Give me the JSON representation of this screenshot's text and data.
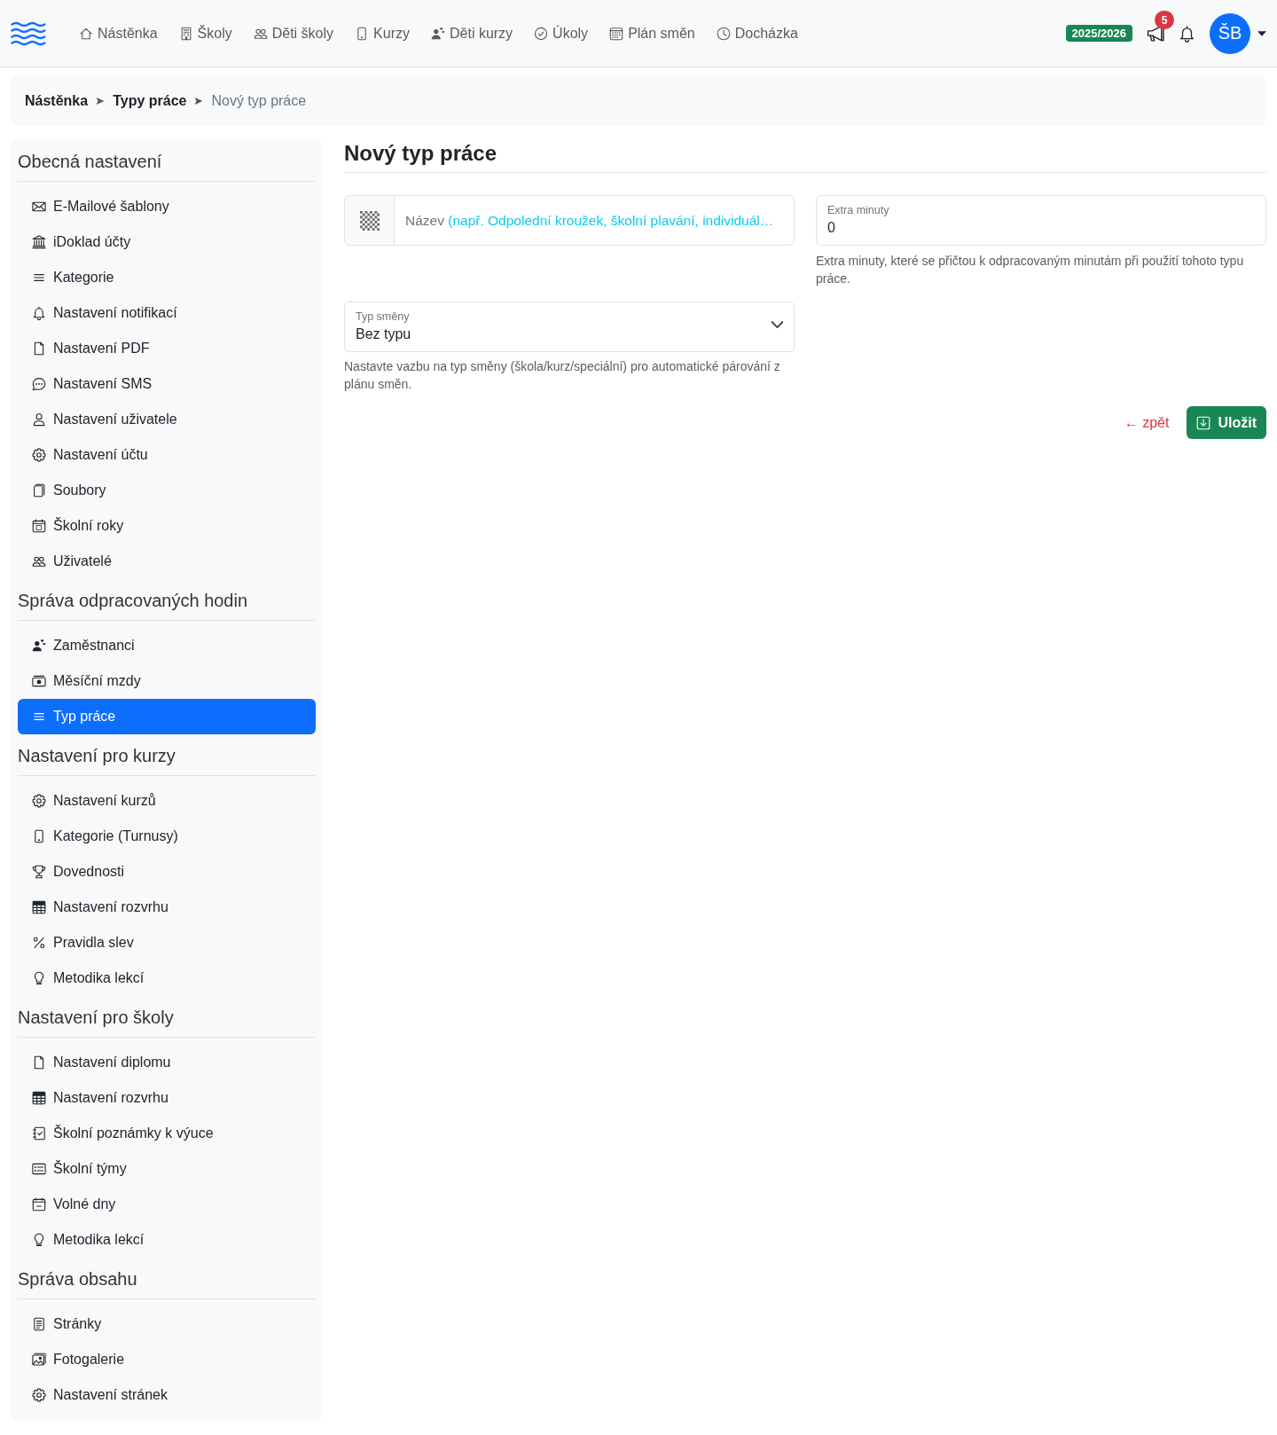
{
  "navbar": {
    "nav_items": [
      {
        "label": "Nástěnka"
      },
      {
        "label": "Školy"
      },
      {
        "label": "Děti školy"
      },
      {
        "label": "Kurzy"
      },
      {
        "label": "Děti kurzy"
      },
      {
        "label": "Úkoly"
      },
      {
        "label": "Plán směn"
      },
      {
        "label": "Docházka"
      }
    ],
    "school_year": "2025/2026",
    "announcements_badge": "5",
    "user_initials": "ŠB"
  },
  "breadcrumb": [
    {
      "label": "Nástěnka",
      "current": false
    },
    {
      "label": "Typy práce",
      "current": false
    },
    {
      "label": "Nový typ práce",
      "current": true
    }
  ],
  "sidebar": {
    "sections": [
      {
        "heading": "Obecná nastavení",
        "items": [
          {
            "label": "E-Mailové šablony",
            "selected": false
          },
          {
            "label": "iDoklad účty",
            "selected": false
          },
          {
            "label": "Kategorie",
            "selected": false
          },
          {
            "label": "Nastavení notifikací",
            "selected": false
          },
          {
            "label": "Nastavení PDF",
            "selected": false
          },
          {
            "label": "Nastavení SMS",
            "selected": false
          },
          {
            "label": "Nastavení uživatele",
            "selected": false
          },
          {
            "label": "Nastavení účtu",
            "selected": false
          },
          {
            "label": "Soubory",
            "selected": false
          },
          {
            "label": "Školní roky",
            "selected": false
          },
          {
            "label": "Uživatelé",
            "selected": false
          }
        ]
      },
      {
        "heading": "Správa odpracovaných hodin",
        "items": [
          {
            "label": "Zaměstnanci",
            "selected": false
          },
          {
            "label": "Měsíční mzdy",
            "selected": false
          },
          {
            "label": "Typ práce",
            "selected": true
          }
        ]
      },
      {
        "heading": "Nastavení pro kurzy",
        "items": [
          {
            "label": "Nastavení kurzů",
            "selected": false
          },
          {
            "label": "Kategorie (Turnusy)",
            "selected": false
          },
          {
            "label": "Dovednosti",
            "selected": false
          },
          {
            "label": "Nastavení rozvrhu",
            "selected": false
          },
          {
            "label": "Pravidla slev",
            "selected": false
          },
          {
            "label": "Metodika lekcí",
            "selected": false
          }
        ]
      },
      {
        "heading": "Nastavení pro školy",
        "items": [
          {
            "label": "Nastavení diplomu",
            "selected": false
          },
          {
            "label": "Nastavení rozvrhu",
            "selected": false
          },
          {
            "label": "Školní poznámky k výuce",
            "selected": false
          },
          {
            "label": "Školní týmy",
            "selected": false
          },
          {
            "label": "Volné dny",
            "selected": false
          },
          {
            "label": "Metodika lekcí",
            "selected": false
          }
        ]
      },
      {
        "heading": "Správa obsahu",
        "items": [
          {
            "label": "Stránky",
            "selected": false
          },
          {
            "label": "Fotogalerie",
            "selected": false
          },
          {
            "label": "Nastavení stránek",
            "selected": false
          }
        ]
      }
    ]
  },
  "page": {
    "title": "Nový typ práce"
  },
  "form": {
    "name_field": {
      "label": "Název",
      "hint": "(např. Odpolední kroužek, školní plavání, individuál…"
    },
    "extra_minutes": {
      "label": "Extra minuty",
      "value": "0",
      "help": "Extra minuty, které se přičtou k odpracovaným minutám při použití tohoto typu práce."
    },
    "shift_type": {
      "label": "Typ směny",
      "value": "Bez typu",
      "help": "Nastavte vazbu na typ směny (škola/kurz/speciální) pro automatické párování z plánu směn."
    }
  },
  "actions": {
    "back_link": "← zpět",
    "save_button": "Uložit"
  }
}
